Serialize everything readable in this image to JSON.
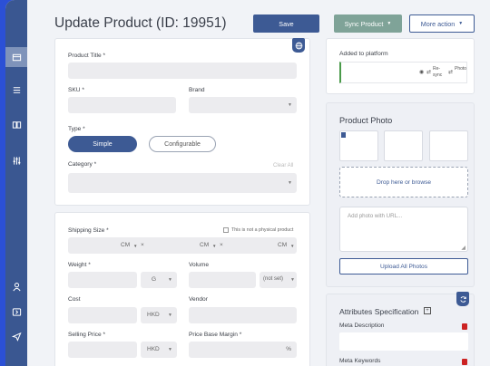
{
  "header": {
    "title": "Update Product (ID: 19951)",
    "save_label": "Save",
    "sync_label": "Sync Product",
    "more_label": "More action"
  },
  "sidebar": {
    "items": [
      {
        "icon": "product-icon",
        "active": true
      },
      {
        "icon": "list-icon",
        "active": false
      },
      {
        "icon": "book-icon",
        "active": false
      },
      {
        "icon": "sliders-icon",
        "active": false
      },
      {
        "icon": "user-icon",
        "active": false
      },
      {
        "icon": "exit-icon",
        "active": false
      },
      {
        "icon": "send-icon",
        "active": false
      }
    ]
  },
  "general": {
    "product_title_label": "Product Title *",
    "sku_label": "SKU *",
    "brand_label": "Brand",
    "type_label": "Type *",
    "type_simple": "Simple",
    "type_configurable": "Configurable",
    "category_label": "Category *",
    "clear_all": "Clear All"
  },
  "shipping": {
    "shipping_size_label": "Shipping Size *",
    "not_physical_label": "This is not a physical product",
    "unit_cm": "CM",
    "weight_label": "Weight *",
    "weight_unit": "G",
    "volume_label": "Volume",
    "volume_unit": "(not set)",
    "cost_label": "Cost",
    "currency": "HKD",
    "vendor_label": "Vendor",
    "selling_price_label": "Selling Price *",
    "base_margin_label": "Price Base Margin *",
    "percent": "%"
  },
  "platform": {
    "added_label": "Added to platform",
    "resync": "Re-sync",
    "photo": "Photo"
  },
  "photo": {
    "title": "Product Photo",
    "drop_label": "Drop here or browse",
    "url_placeholder": "Add photo with URL...",
    "upload_label": "Upload All Photos"
  },
  "attributes": {
    "title": "Attributes Specification",
    "meta_description_label": "Meta Description",
    "meta_keywords_label": "Meta Keywords"
  },
  "colors": {
    "sidebar": "#3a5791",
    "primary": "#3d5a94",
    "sync": "#7fa398",
    "frame": "#2b50d6",
    "delete": "#cc2222"
  }
}
